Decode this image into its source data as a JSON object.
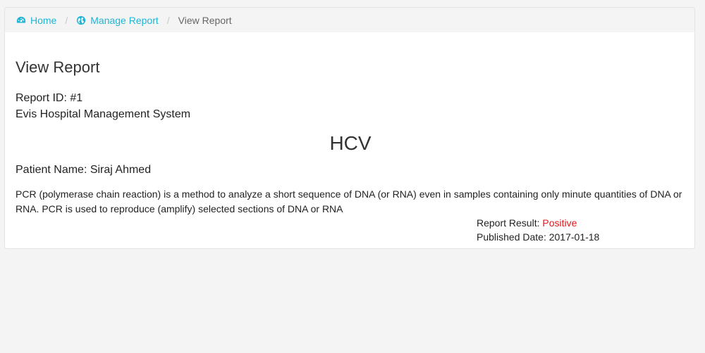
{
  "breadcrumb": {
    "home": "Home",
    "manage_report": "Manage Report",
    "current": "View Report",
    "separator": "/"
  },
  "page": {
    "title": "View Report"
  },
  "report": {
    "id_line": "Report ID: #1",
    "organization": "Evis Hospital Management System",
    "name": "HCV",
    "patient_line": "Patient Name: Siraj Ahmed",
    "description": "PCR (polymerase chain reaction) is a method to analyze a short sequence of DNA (or RNA) even in samples containing only minute quantities of DNA or RNA. PCR is used to reproduce (amplify) selected sections of DNA or RNA",
    "result_label": "Report Result: ",
    "result_value": "Positive",
    "published_line": "Published Date: 2017-01-18"
  },
  "colors": {
    "link": "#1fb5d6",
    "positive": "#e3161b",
    "page_background": "#f4f4f4"
  },
  "icons": {
    "home": "dashboard-icon",
    "manage_report": "globe-icon"
  }
}
